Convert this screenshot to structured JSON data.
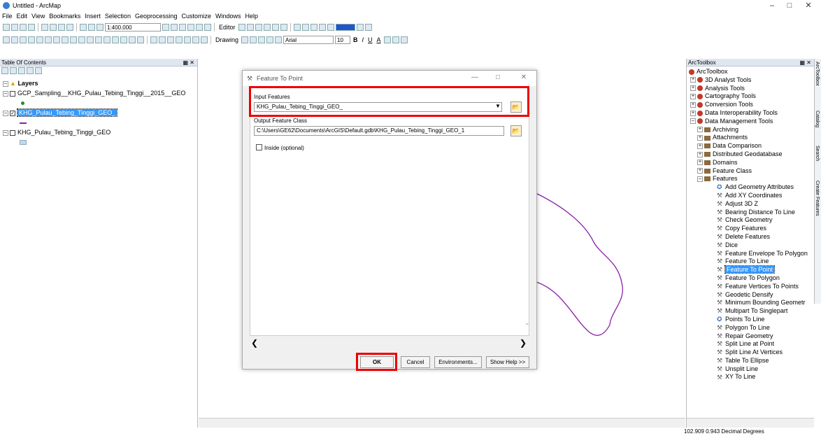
{
  "app": {
    "title": "Untitled - ArcMap"
  },
  "menu": [
    "File",
    "Edit",
    "View",
    "Bookmarks",
    "Insert",
    "Selection",
    "Geoprocessing",
    "Customize",
    "Windows",
    "Help"
  ],
  "toolbar": {
    "scale": "1:400.000",
    "editor": "Editor",
    "drawing": "Drawing",
    "font": "Arial",
    "font_size": "10",
    "bold": "B",
    "italic": "I",
    "underline": "U",
    "text_a": "A"
  },
  "toc": {
    "title": "Table Of Contents",
    "root": "Layers",
    "layers": [
      {
        "name": "GCP_Sampling__KHG_Pulau_Tebing_Tinggi__2015__GEO"
      },
      {
        "name": "KHG_Pulau_Tebing_Tinggi_GEO_"
      },
      {
        "name": "KHG_Pulau_Tebing_Tinggi_GEO"
      }
    ]
  },
  "dialog": {
    "title": "Feature To Point",
    "input_label": "Input Features",
    "input_value": "KHG_Pulau_Tebing_Tinggi_GEO_",
    "output_label": "Output Feature Class",
    "output_value": "C:\\Users\\GE62\\Documents\\ArcGIS\\Default.gdb\\KHG_Pulau_Tebing_Tinggi_GEO_1",
    "inside_label": "Inside (optional)",
    "ok": "OK",
    "cancel": "Cancel",
    "environments": "Environments...",
    "help": "Show Help >>"
  },
  "toolbox": {
    "title": "ArcToolbox",
    "root": "ArcToolbox",
    "toolboxes": [
      "3D Analyst Tools",
      "Analysis Tools",
      "Cartography Tools",
      "Conversion Tools",
      "Data Interoperability Tools",
      "Data Management Tools"
    ],
    "toolsets": [
      "Archiving",
      "Attachments",
      "Data Comparison",
      "Distributed Geodatabase",
      "Domains",
      "Feature Class",
      "Features"
    ],
    "tools": [
      "Add Geometry Attributes",
      "Add XY Coordinates",
      "Adjust 3D Z",
      "Bearing Distance To Line",
      "Check Geometry",
      "Copy Features",
      "Delete Features",
      "Dice",
      "Feature Envelope To Polygon",
      "Feature To Line",
      "Feature To Point",
      "Feature To Polygon",
      "Feature Vertices To Points",
      "Geodetic Densify",
      "Minimum Bounding Geometr",
      "Multipart To Singlepart",
      "Points To Line",
      "Polygon To Line",
      "Repair Geometry",
      "Split Line at Point",
      "Split Line At Vertices",
      "Table To Ellipse",
      "Unsplit Line",
      "XY To Line"
    ],
    "selected_tool": "Feature To Point",
    "side_tabs": [
      "ArcToolbox",
      "Catalog",
      "Search",
      "Create Features"
    ]
  },
  "status": {
    "coords": "102.909  0.943 Decimal Degrees"
  },
  "colors": {
    "highlight": "#e00000",
    "selection": "#3399ff",
    "feature_line": "#8b1fa8"
  }
}
